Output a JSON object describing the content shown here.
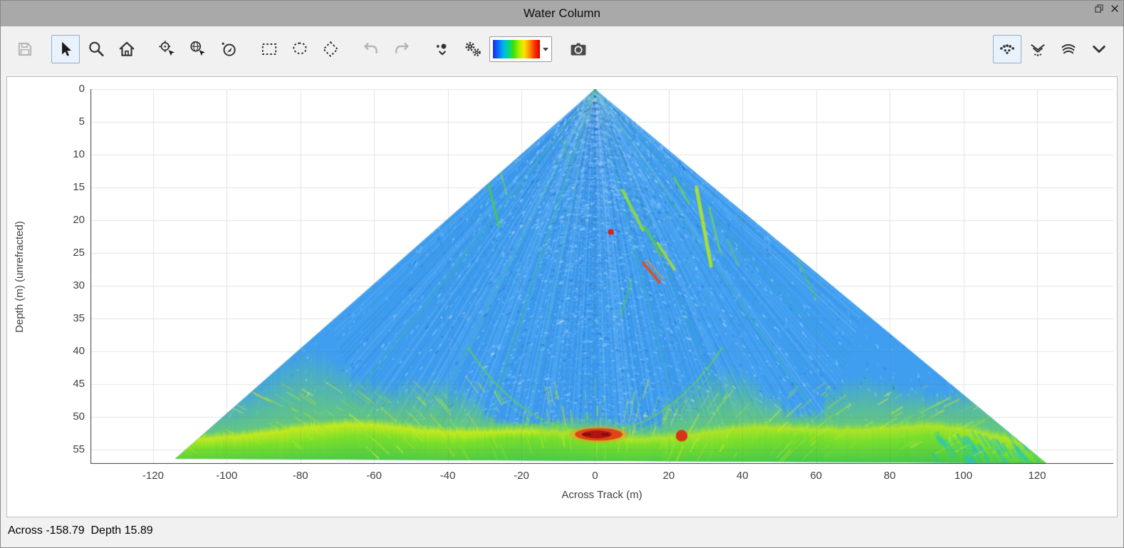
{
  "window": {
    "title": "Water Column"
  },
  "toolbar": {
    "groups": [
      {
        "buttons": [
          {
            "name": "save-button",
            "icon": "save-icon",
            "disabled": true
          }
        ]
      },
      {
        "buttons": [
          {
            "name": "select-cursor-button",
            "icon": "cursor-icon",
            "selected": true
          },
          {
            "name": "zoom-button",
            "icon": "magnifier-icon"
          },
          {
            "name": "home-view-button",
            "icon": "home-icon"
          }
        ]
      },
      {
        "buttons": [
          {
            "name": "pick-position-button",
            "icon": "crosshair-cursor-icon"
          },
          {
            "name": "pick-geo-button",
            "icon": "globe-cursor-icon"
          },
          {
            "name": "pick-beam-button",
            "icon": "compass-cursor-icon"
          }
        ]
      },
      {
        "buttons": [
          {
            "name": "rectangle-select-button",
            "icon": "rectangle-select-icon"
          },
          {
            "name": "lasso-select-button",
            "icon": "lasso-select-icon"
          },
          {
            "name": "polygon-select-button",
            "icon": "polygon-select-icon"
          }
        ]
      },
      {
        "buttons": [
          {
            "name": "undo-button",
            "icon": "undo-icon",
            "disabled": true
          },
          {
            "name": "redo-button",
            "icon": "redo-icon",
            "disabled": true
          }
        ]
      },
      {
        "buttons": [
          {
            "name": "point-display-options-button",
            "icon": "points-dropdown-icon"
          },
          {
            "name": "settings-button",
            "icon": "gears-icon"
          },
          {
            "name": "colormap-selector",
            "icon": "colormap-bar"
          }
        ]
      },
      {
        "buttons": [
          {
            "name": "snapshot-button",
            "icon": "camera-icon"
          }
        ]
      }
    ],
    "right_groups": [
      {
        "buttons": [
          {
            "name": "points-view-button",
            "icon": "scatter-view-icon",
            "selected": true
          },
          {
            "name": "wiggle-view-button",
            "icon": "wiggle-view-icon"
          },
          {
            "name": "stacked-view-button",
            "icon": "stacked-arcs-icon"
          },
          {
            "name": "more-views-button",
            "icon": "chevron-down-icon"
          }
        ]
      }
    ],
    "colormap": [
      "#1c2bee",
      "#0a6cff",
      "#00b4e8",
      "#00d890",
      "#44e000",
      "#a8ee00",
      "#ffe400",
      "#ff9000",
      "#ff3000",
      "#cc0400"
    ]
  },
  "status": {
    "text": "Across -158.79  Depth 15.89"
  },
  "chart_data": {
    "type": "heatmap",
    "title": "",
    "xlabel": "Across Track (m)",
    "ylabel": "Depth (m) (unrefracted)",
    "x_ticks": [
      -120,
      -100,
      -80,
      -60,
      -40,
      -20,
      0,
      20,
      40,
      60,
      80,
      100,
      120
    ],
    "y_ticks": [
      0,
      5,
      10,
      15,
      20,
      25,
      30,
      35,
      40,
      45,
      50,
      55
    ],
    "x_range": [
      -137,
      140.7
    ],
    "y_range": [
      0,
      57.2
    ],
    "grid": true,
    "fan": {
      "apex": [
        0,
        0
      ],
      "left_corner": [
        -114,
        56.4
      ],
      "right_corner": [
        122.5,
        57.1
      ],
      "beam_half_angle_deg": 64,
      "water_color": "#3f9ef0",
      "seafloor_depth_m": 52.3,
      "seafloor_color": "#b9e626",
      "slant_range_arc_m": 52.4,
      "strong_return": {
        "across": 1.0,
        "depth": 52.7
      },
      "point_targets": [
        {
          "across": 4.3,
          "depth": 21.8,
          "color": "#e02016",
          "r_m": 0.8
        },
        {
          "across": 23.5,
          "depth": 52.9,
          "color": "#d83418",
          "r_m": 1.6
        }
      ],
      "midwater_features": [
        {
          "from": [
            -29,
            14.5
          ],
          "to": [
            -26,
            21
          ],
          "color": "#49d22c",
          "width": 3,
          "alpha": 0.75
        },
        {
          "from": [
            -26,
            12
          ],
          "to": [
            -24,
            16
          ],
          "color": "#7ce03a",
          "width": 2.5,
          "alpha": 0.5
        },
        {
          "from": [
            7.5,
            15.5
          ],
          "to": [
            13,
            21.5
          ],
          "color": "#8fe02e",
          "width": 4.5,
          "alpha": 0.85
        },
        {
          "from": [
            13.5,
            21
          ],
          "to": [
            18,
            25.5
          ],
          "color": "#5ad02e",
          "width": 3.5,
          "alpha": 0.7
        },
        {
          "from": [
            17,
            23.5
          ],
          "to": [
            21.5,
            27.5
          ],
          "color": "#a8e428",
          "width": 4,
          "alpha": 0.8
        },
        {
          "from": [
            21.5,
            13.5
          ],
          "to": [
            25.5,
            17.5
          ],
          "color": "#6bdc30",
          "width": 3,
          "alpha": 0.65
        },
        {
          "from": [
            27.5,
            15
          ],
          "to": [
            31.5,
            27
          ],
          "color": "#b2e626",
          "width": 5,
          "alpha": 0.9
        },
        {
          "from": [
            31,
            18
          ],
          "to": [
            34,
            25
          ],
          "color": "#7ce03a",
          "width": 3,
          "alpha": 0.6
        },
        {
          "from": [
            10,
            29
          ],
          "to": [
            7,
            34.5
          ],
          "color": "#4ecf3a",
          "width": 2.5,
          "alpha": 0.55
        },
        {
          "from": [
            36,
            23
          ],
          "to": [
            39,
            27
          ],
          "color": "#62d435",
          "width": 2.5,
          "alpha": 0.5
        },
        {
          "from": [
            -9,
            7.5
          ],
          "to": [
            -7,
            11
          ],
          "color": "#62d435",
          "width": 2,
          "alpha": 0.4
        },
        {
          "from": [
            55,
            26
          ],
          "to": [
            60,
            32
          ],
          "color": "#55d038",
          "width": 3,
          "alpha": 0.45
        },
        {
          "from": [
            13,
            26.5
          ],
          "to": [
            17.5,
            29.5
          ],
          "color": "#e84a18",
          "width": 4,
          "alpha": 0.9
        },
        {
          "from": [
            14,
            26
          ],
          "to": [
            18.5,
            29
          ],
          "color": "#f09a20",
          "width": 2,
          "alpha": 0.7
        }
      ]
    }
  }
}
